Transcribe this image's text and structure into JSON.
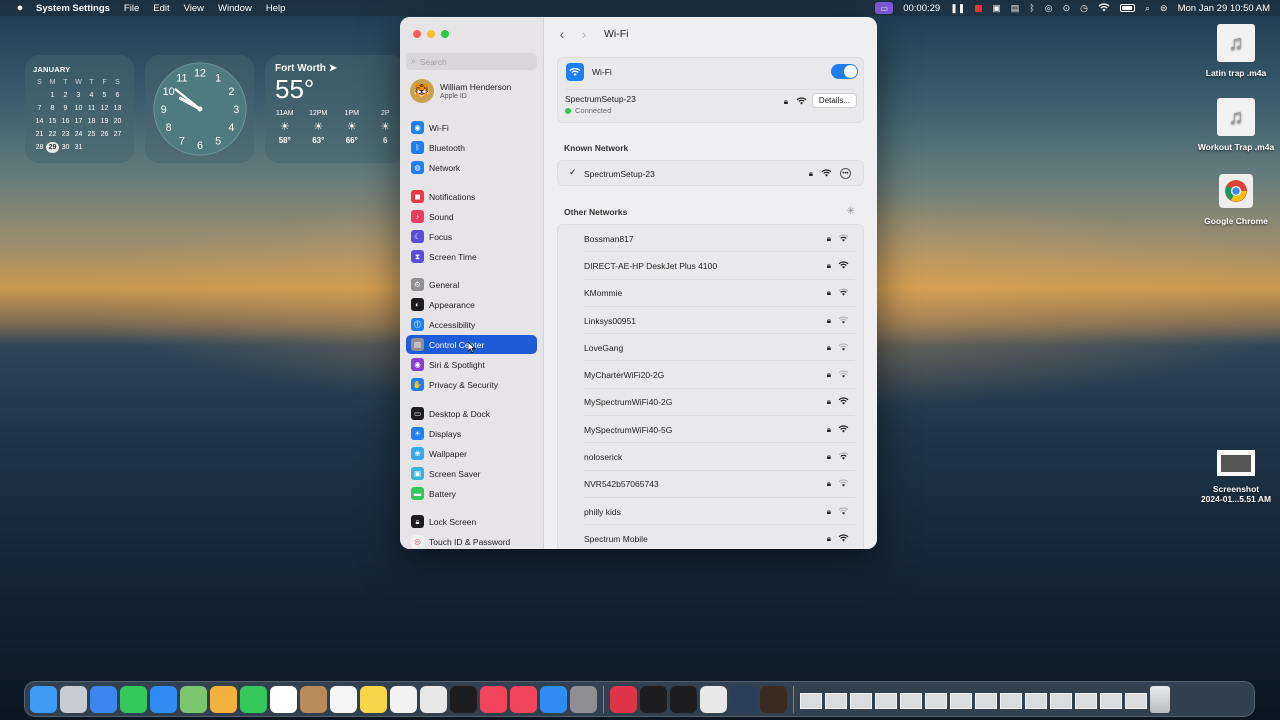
{
  "menubar": {
    "app_name": "System Settings",
    "menus": [
      "File",
      "Edit",
      "View",
      "Window",
      "Help"
    ],
    "timer": "00:00:29",
    "datetime": "Mon Jan 29  10:50 AM"
  },
  "widgets": {
    "calendar": {
      "month": "JANUARY",
      "weekday_headers": [
        "S",
        "M",
        "T",
        "W",
        "T",
        "F",
        "S"
      ],
      "days": [
        "",
        "1",
        "2",
        "3",
        "4",
        "5",
        "6",
        "7",
        "8",
        "9",
        "10",
        "11",
        "12",
        "13",
        "14",
        "15",
        "16",
        "17",
        "18",
        "19",
        "20",
        "21",
        "22",
        "23",
        "24",
        "25",
        "26",
        "27",
        "28",
        "29",
        "30",
        "31"
      ],
      "today": "29"
    },
    "clock": {
      "numerals": [
        "12",
        "1",
        "2",
        "3",
        "4",
        "5",
        "6",
        "7",
        "8",
        "9",
        "10",
        "11"
      ]
    },
    "weather": {
      "city": "Fort Worth",
      "temperature": "55°",
      "hours": [
        {
          "time": "11AM",
          "temp": "58°"
        },
        {
          "time": "12PM",
          "temp": "63°"
        },
        {
          "time": "1PM",
          "temp": "66°"
        },
        {
          "time": "2P",
          "temp": "6"
        }
      ]
    }
  },
  "desktop_icons": [
    {
      "label": "Latin trap .m4a",
      "icon": "music-file-icon"
    },
    {
      "label": "Workout Trap .m4a",
      "icon": "music-file-icon"
    },
    {
      "label": "Google Chrome",
      "icon": "chrome-icon"
    },
    {
      "label": "Screenshot\n2024-01...5.51 AM",
      "icon": "screenshot-file-icon"
    }
  ],
  "window": {
    "sidebar": {
      "search_placeholder": "Search",
      "account": {
        "name": "William Henderson",
        "subtitle": "Apple ID"
      },
      "items": [
        {
          "label": "Wi-Fi",
          "icon": "wifi-icon",
          "color": "#1e7ef2"
        },
        {
          "label": "Bluetooth",
          "icon": "bluetooth-icon",
          "color": "#1e7ef2"
        },
        {
          "label": "Network",
          "icon": "globe-icon",
          "color": "#1e7ef2"
        },
        {
          "label": "Notifications",
          "icon": "bell-icon",
          "color": "#ea3b45"
        },
        {
          "label": "Sound",
          "icon": "speaker-icon",
          "color": "#ea3b62"
        },
        {
          "label": "Focus",
          "icon": "moon-icon",
          "color": "#5b4bd6"
        },
        {
          "label": "Screen Time",
          "icon": "hourglass-icon",
          "color": "#5b4bd6"
        },
        {
          "label": "General",
          "icon": "gear-icon",
          "color": "#8e8e93"
        },
        {
          "label": "Appearance",
          "icon": "appearance-icon",
          "color": "#1d1d1f"
        },
        {
          "label": "Accessibility",
          "icon": "accessibility-icon",
          "color": "#1e7ef2"
        },
        {
          "label": "Control Center",
          "icon": "control-center-icon",
          "color": "#8e8e93"
        },
        {
          "label": "Siri & Spotlight",
          "icon": "siri-icon",
          "color": "#8b3cd4"
        },
        {
          "label": "Privacy & Security",
          "icon": "hand-icon",
          "color": "#1e7ef2"
        },
        {
          "label": "Desktop & Dock",
          "icon": "dock-icon",
          "color": "#1d1d1f"
        },
        {
          "label": "Displays",
          "icon": "sun-icon",
          "color": "#1e7ef2"
        },
        {
          "label": "Wallpaper",
          "icon": "wallpaper-icon",
          "color": "#38a8e8"
        },
        {
          "label": "Screen Saver",
          "icon": "screensaver-icon",
          "color": "#38b4d8"
        },
        {
          "label": "Battery",
          "icon": "battery-icon",
          "color": "#34c759"
        },
        {
          "label": "Lock Screen",
          "icon": "lock-icon",
          "color": "#1d1d1f"
        },
        {
          "label": "Touch ID & Password",
          "icon": "fingerprint-icon",
          "color": "#f0f0f0"
        }
      ],
      "selected": "Control Center"
    },
    "main": {
      "title": "Wi-Fi",
      "wifi_label": "Wi-Fi",
      "wifi_enabled": true,
      "connected_network": "SpectrumSetup-23",
      "connected_status": "Connected",
      "details_button": "Details...",
      "known_network_heading": "Known Network",
      "known_network": "SpectrumSetup-23",
      "other_networks_heading": "Other Networks",
      "other_networks": [
        {
          "name": "Bossman817",
          "signal": "medium"
        },
        {
          "name": "DIRECT-AE-HP DeskJet Plus 4100",
          "signal": "strong"
        },
        {
          "name": "KMommie",
          "signal": "medium"
        },
        {
          "name": "Linksys00951",
          "signal": "weak"
        },
        {
          "name": "LoveGang",
          "signal": "weak"
        },
        {
          "name": "MyCharterWiFi20-2G",
          "signal": "weak"
        },
        {
          "name": "MySpectrumWiFi40-2G",
          "signal": "strong"
        },
        {
          "name": "MySpectrumWiFi40-5G",
          "signal": "strong"
        },
        {
          "name": "noloserick",
          "signal": "medium"
        },
        {
          "name": "NVR542b57065743",
          "signal": "weak"
        },
        {
          "name": "philly kids",
          "signal": "weak"
        },
        {
          "name": "Spectrum Mobile",
          "signal": "strong"
        }
      ]
    }
  },
  "dock": {
    "apps": [
      {
        "name": "finder-icon",
        "color": "#3e9bf4"
      },
      {
        "name": "launchpad-icon",
        "color": "#c7cbd3"
      },
      {
        "name": "safari-icon",
        "color": "#3c86f0"
      },
      {
        "name": "messages-icon",
        "color": "#34c759"
      },
      {
        "name": "mail-icon",
        "color": "#2f8cf2"
      },
      {
        "name": "maps-icon",
        "color": "#7cc66d"
      },
      {
        "name": "photos-icon",
        "color": "#f4b23c"
      },
      {
        "name": "facetime-icon",
        "color": "#34c759"
      },
      {
        "name": "calendar-icon",
        "color": "#ffffff"
      },
      {
        "name": "contacts-icon",
        "color": "#b98b5a"
      },
      {
        "name": "reminders-icon",
        "color": "#f5f5f5"
      },
      {
        "name": "notes-icon",
        "color": "#f7d64a"
      },
      {
        "name": "freeform-icon",
        "color": "#f2f2f2"
      },
      {
        "name": "chrome-icon",
        "color": "#e8e8e8"
      },
      {
        "name": "tv-icon",
        "color": "#1d1d1f"
      },
      {
        "name": "music-icon",
        "color": "#f2445a"
      },
      {
        "name": "news-icon",
        "color": "#f2445a"
      },
      {
        "name": "app-store-icon",
        "color": "#2f8cf2"
      },
      {
        "name": "system-settings-icon",
        "color": "#8e8e93"
      },
      {
        "name": "screen-recorder-icon",
        "color": "#e0344a"
      },
      {
        "name": "capcut-icon",
        "color": "#1d1d1f"
      },
      {
        "name": "play-store-icon",
        "color": "#1d1d1f"
      },
      {
        "name": "chrome-alt-icon",
        "color": "#e8e8e8"
      },
      {
        "name": "quicktime-icon",
        "color": "#2a3f5a"
      },
      {
        "name": "garageband-icon",
        "color": "#3a2a1f"
      }
    ],
    "stack_count": 14
  }
}
